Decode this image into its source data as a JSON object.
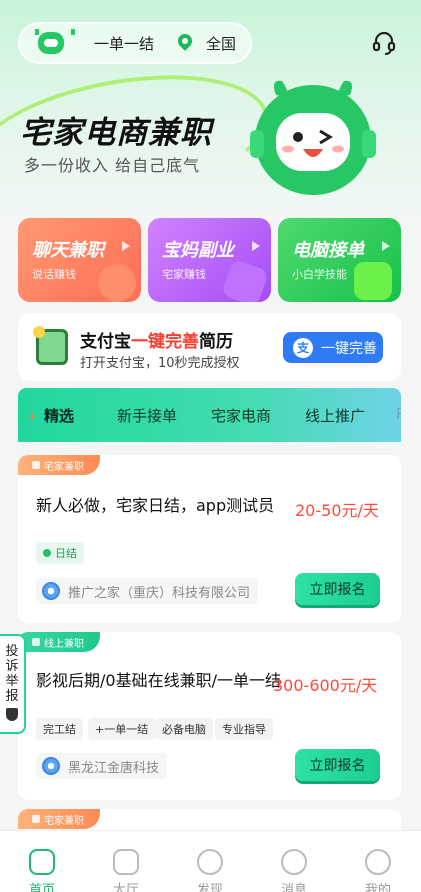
{
  "top_bar": {
    "slogan": "一单一结",
    "location": "全国"
  },
  "hero": {
    "headline": "宅家电商兼职",
    "subline": "多一份收入 给自己底气"
  },
  "categories": [
    {
      "title": "聊天兼职",
      "subtitle": "说话赚钱"
    },
    {
      "title": "宝妈副业",
      "subtitle": "宅家赚钱"
    },
    {
      "title": "电脑接单",
      "subtitle": "小白学技能"
    }
  ],
  "alipay": {
    "title_prefix": "支付宝",
    "title_highlight": "一键完善",
    "title_suffix": "简历",
    "subtitle": "打开支付宝，10秒完成授权",
    "button_icon": "支",
    "button_label": "一键完善"
  },
  "tabs": [
    "精选",
    "新手接单",
    "宅家电商",
    "线上推广",
    "P"
  ],
  "jobs": [
    {
      "category_tag": "宅家兼职",
      "title": "新人必做，宅家日结，app测试员",
      "salary": "20-50元/天",
      "badges": [
        "日结"
      ],
      "company": "推广之家（重庆）科技有限公司",
      "apply_label": "立即报名"
    },
    {
      "category_tag": "线上兼职",
      "title": "影视后期/0基础在线兼职/一单一结",
      "salary": "300-600元/天",
      "badges": [
        "完工结",
        "+一单一结",
        "必备电脑",
        "专业指导"
      ],
      "company": "黑龙江金唐科技",
      "apply_label": "立即报名"
    },
    {
      "category_tag": "宅家兼职"
    }
  ],
  "report": {
    "label": "投诉举报"
  },
  "bottom_nav": [
    {
      "label": "首页",
      "icon": "home-icon",
      "active": true
    },
    {
      "label": "大厅",
      "icon": "hall-icon",
      "active": false
    },
    {
      "label": "发现",
      "icon": "planet-icon",
      "active": false
    },
    {
      "label": "消息",
      "icon": "message-icon",
      "active": false
    },
    {
      "label": "我的",
      "icon": "profile-icon",
      "active": false
    }
  ],
  "colors": {
    "brand_green": "#1cba72",
    "salary_red": "#ff4b3a",
    "alipay_blue": "#2f7bf6"
  }
}
